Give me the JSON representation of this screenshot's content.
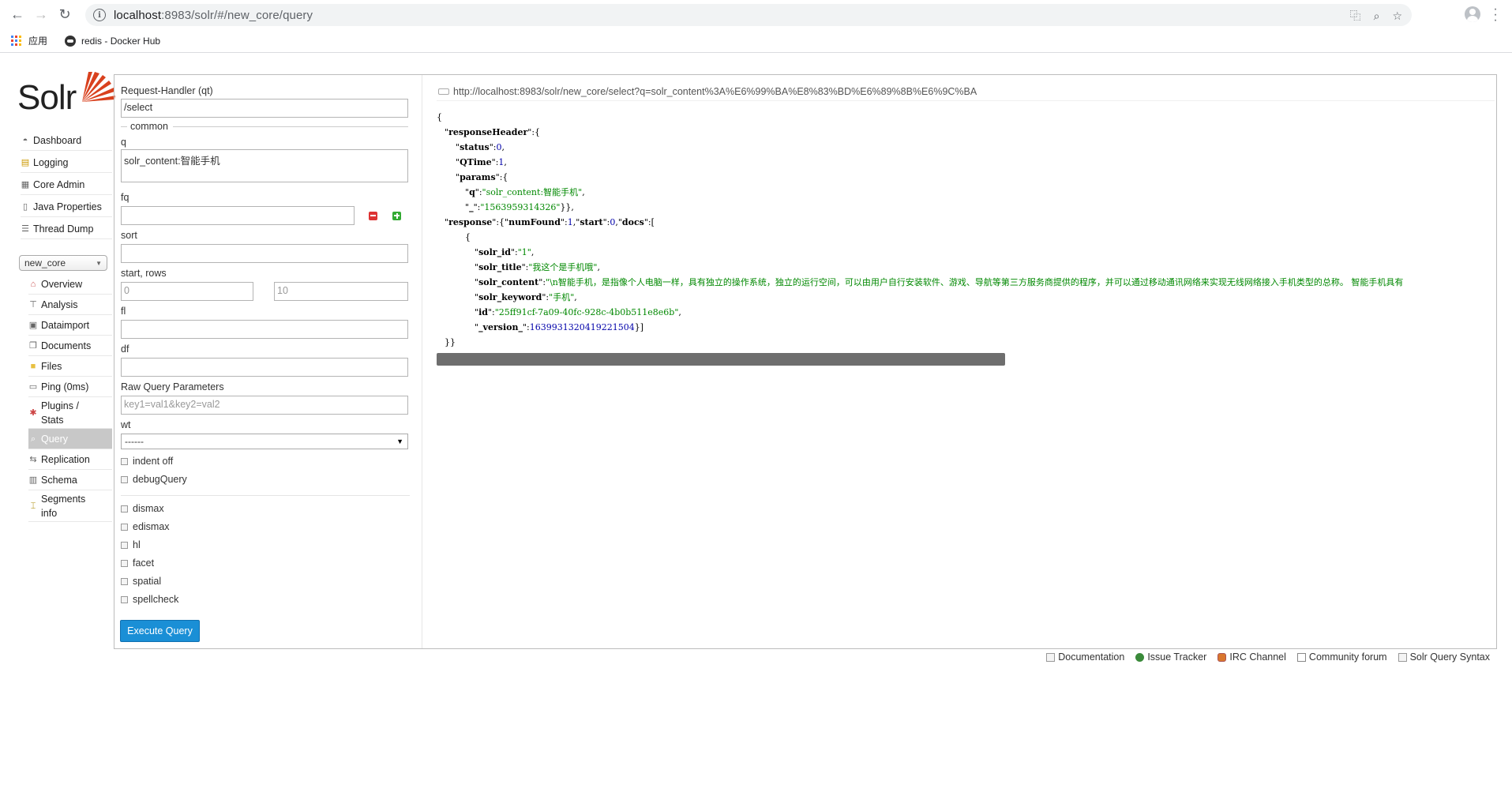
{
  "browser": {
    "url_host": "localhost",
    "url_rest": ":8983/solr/#/new_core/query",
    "bookmarks": [
      {
        "label": "应用"
      },
      {
        "label": "redis - Docker Hub"
      }
    ]
  },
  "logo": {
    "text": "Solr"
  },
  "sidebar": {
    "items": [
      {
        "label": "Dashboard"
      },
      {
        "label": "Logging"
      },
      {
        "label": "Core Admin"
      },
      {
        "label": "Java Properties"
      },
      {
        "label": "Thread Dump"
      }
    ],
    "core_selector": "new_core",
    "core_items": [
      {
        "label": "Overview"
      },
      {
        "label": "Analysis"
      },
      {
        "label": "Dataimport"
      },
      {
        "label": "Documents"
      },
      {
        "label": "Files"
      },
      {
        "label": "Ping (0ms)"
      },
      {
        "label1": "Plugins /",
        "label2": "Stats"
      },
      {
        "label": "Query"
      },
      {
        "label": "Replication"
      },
      {
        "label": "Schema"
      },
      {
        "label1": "Segments",
        "label2": "info"
      }
    ]
  },
  "form": {
    "request_handler_label": "Request-Handler (qt)",
    "request_handler_value": "/select",
    "common_legend": "common",
    "q_label": "q",
    "q_value": "solr_content:智能手机",
    "fq_label": "fq",
    "fq_value": "",
    "sort_label": "sort",
    "sort_value": "",
    "start_rows_label": "start, rows",
    "start_value": "0",
    "rows_value": "10",
    "fl_label": "fl",
    "fl_value": "",
    "df_label": "df",
    "df_value": "",
    "raw_label": "Raw Query Parameters",
    "raw_placeholder": "key1=val1&key2=val2",
    "wt_label": "wt",
    "wt_value": "------",
    "checks": [
      "indent off",
      "debugQuery"
    ],
    "options": [
      "dismax",
      "edismax",
      "hl",
      "facet",
      "spatial",
      "spellcheck"
    ],
    "execute_label": "Execute Query"
  },
  "result": {
    "url": "http://localhost:8983/solr/new_core/select?q=solr_content%3A%E6%99%BA%E8%83%BD%E6%89%8B%E6%9C%BA",
    "status": "0",
    "qtime": "1",
    "param_q": "\"solr_content:智能手机\"",
    "param_underscore": "\"1563959314326\"",
    "num_found": "1",
    "start": "0",
    "doc_solr_id": "\"1\"",
    "doc_solr_title": "\"我这个是手机哦\"",
    "doc_solr_content": "\"\\n智能手机，是指像个人电脑一样，具有独立的操作系统，独立的运行空间，可以由用户自行安装软件、游戏、导航等第三方服务商提供的程序，并可以通过移动通讯网络来实现无线网络接入手机类型的总称。 智能手机具有",
    "doc_solr_keyword": "\"手机\"",
    "doc_id": "\"25ff91cf-7a09-40fc-928c-4b0b511e8e6b\"",
    "doc_version": "1639931320419221504"
  },
  "footer": {
    "links": [
      "Documentation",
      "Issue Tracker",
      "IRC Channel",
      "Community forum",
      "Solr Query Syntax"
    ]
  }
}
